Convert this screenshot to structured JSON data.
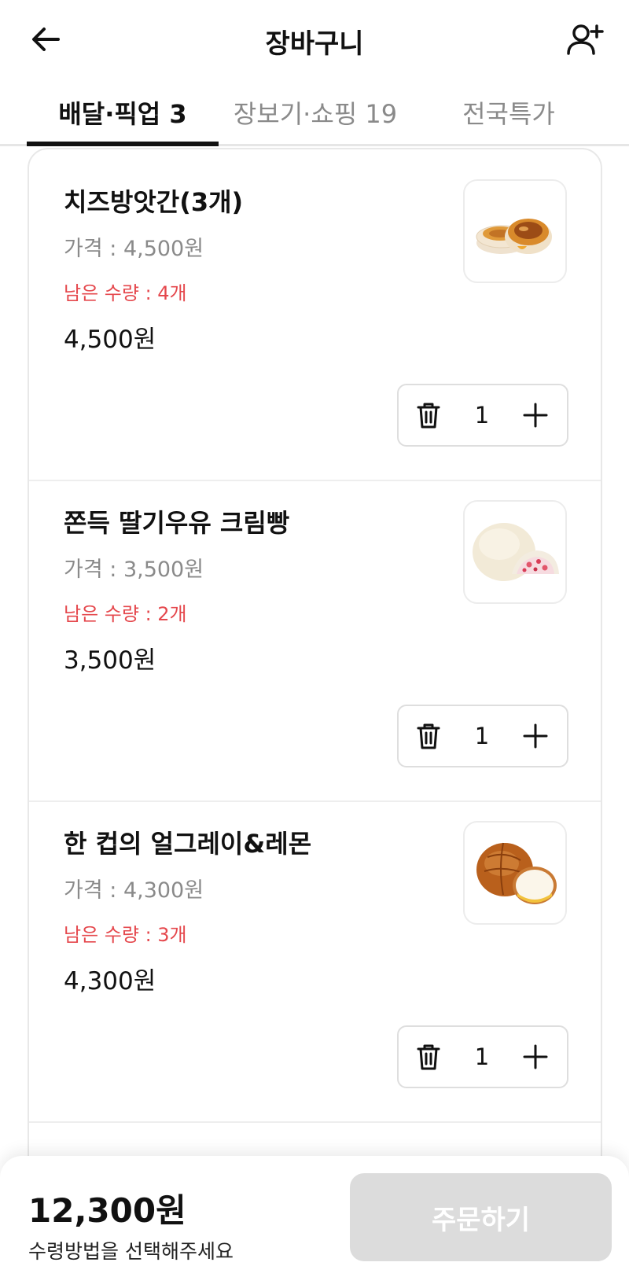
{
  "header": {
    "title": "장바구니",
    "back_icon": "arrow-left-icon",
    "invite_icon": "user-plus-icon"
  },
  "tabs": [
    {
      "label": "배달·픽업 3",
      "active": true
    },
    {
      "label": "장보기·쇼핑 19",
      "active": false
    },
    {
      "label": "전국특가",
      "active": false
    }
  ],
  "cart": {
    "items": [
      {
        "name": "치즈방앗간(3개)",
        "price_label": "가격 : 4,500원",
        "stock_label": "남은 수량 : 4개",
        "total": "4,500원",
        "quantity": "1",
        "image": "cheese-rice-cake-photo"
      },
      {
        "name": "쫀득 딸기우유 크림빵",
        "price_label": "가격 : 3,500원",
        "stock_label": "남은 수량 : 2개",
        "total": "3,500원",
        "quantity": "1",
        "image": "strawberry-cream-bun-photo"
      },
      {
        "name": "한 컵의 얼그레이&레몬",
        "price_label": "가격 : 4,300원",
        "stock_label": "남은 수량 : 3개",
        "total": "4,300원",
        "quantity": "1",
        "image": "earl-grey-lemon-bun-photo"
      }
    ]
  },
  "footer": {
    "total_price": "12,300원",
    "hint": "수령방법을 선택해주세요",
    "order_label": "주문하기"
  },
  "colors": {
    "text_primary": "#111111",
    "text_secondary": "#8a8a8a",
    "stock_red": "#e5484d",
    "order_disabled": "#dcdcdc"
  }
}
